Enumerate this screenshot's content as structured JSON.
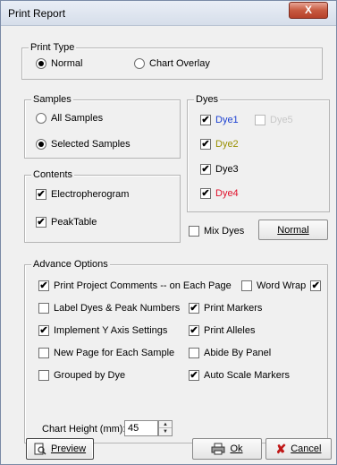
{
  "window": {
    "title": "Print Report",
    "close_label": "X"
  },
  "print_type": {
    "legend": "Print Type",
    "normal_label": "Normal",
    "chart_overlay_label": "Chart Overlay",
    "selected": "Normal"
  },
  "samples": {
    "legend": "Samples",
    "all_label": "All Samples",
    "selected_label": "Selected Samples",
    "selected": "Selected Samples"
  },
  "contents": {
    "legend": "Contents",
    "electropherogram_label": "Electropherogram",
    "electropherogram_checked": true,
    "peaktable_label": "PeakTable",
    "peaktable_checked": true
  },
  "dyes": {
    "legend": "Dyes",
    "items": [
      {
        "label": "Dye1",
        "checked": true,
        "color": "#1a3fd1",
        "enabled": true
      },
      {
        "label": "Dye5",
        "checked": false,
        "color": "#c8c8c8",
        "enabled": false
      },
      {
        "label": "Dye2",
        "checked": true,
        "color": "#999000",
        "enabled": true
      },
      {
        "label": "Dye3",
        "checked": true,
        "color": "#000000",
        "enabled": true
      },
      {
        "label": "Dye4",
        "checked": true,
        "color": "#e0102a",
        "enabled": true
      }
    ],
    "mix_dyes_label": "Mix Dyes",
    "mix_dyes_checked": false,
    "normal_button_label": "Normal"
  },
  "advance": {
    "legend": "Advance Options",
    "print_comments_label": "Print Project Comments  -- on Each Page",
    "print_comments_checked": true,
    "on_each_page_checked": false,
    "word_wrap_label": "Word Wrap",
    "word_wrap_checked": true,
    "label_dyes_label": "Label Dyes & Peak Numbers",
    "label_dyes_checked": false,
    "print_markers_label": "Print Markers",
    "print_markers_checked": true,
    "implement_y_label": "Implement  Y Axis Settings",
    "implement_y_checked": true,
    "print_alleles_label": "Print Alleles",
    "print_alleles_checked": true,
    "new_page_label": "New Page for Each Sample",
    "new_page_checked": false,
    "abide_panel_label": "Abide By Panel",
    "abide_panel_checked": false,
    "grouped_dye_label": "Grouped by Dye",
    "grouped_dye_checked": false,
    "auto_scale_label": "Auto Scale Markers",
    "auto_scale_checked": true,
    "chart_height_label": "Chart Height (mm):",
    "chart_height_value": "45"
  },
  "buttons": {
    "preview_label": "Preview",
    "ok_label": "Ok",
    "cancel_label": "Cancel"
  },
  "check_glyph": "✔"
}
